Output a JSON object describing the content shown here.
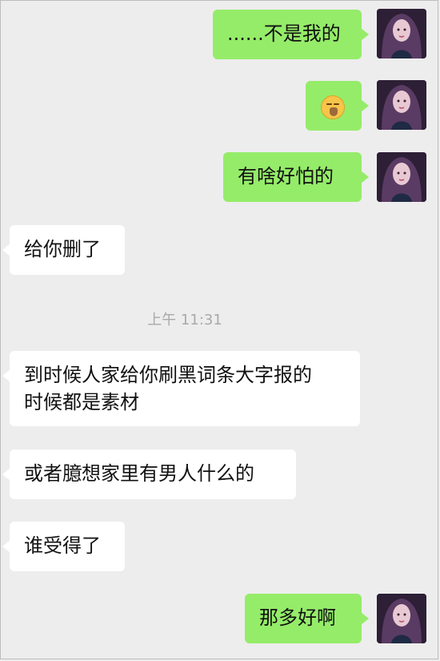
{
  "messages": [
    {
      "side": "out",
      "text": "......不是我的",
      "avatar": "girl-avatar"
    },
    {
      "side": "out",
      "text": "",
      "emoji": "speechless-face-icon",
      "avatar": "girl-avatar"
    },
    {
      "side": "out",
      "text": "有啥好怕的",
      "avatar": "girl-avatar"
    },
    {
      "side": "in",
      "text": "给你删了"
    },
    {
      "side": "in",
      "text_line1": "到时候人家给你刷黑词条大字报的",
      "text_line2": "时候都是素材"
    },
    {
      "side": "in",
      "text": "或者臆想家里有男人什么的"
    },
    {
      "side": "in",
      "text": "谁受得了"
    },
    {
      "side": "out",
      "text": "那多好啊",
      "avatar": "girl-avatar"
    }
  ],
  "timestamp": "上午 11:31",
  "colors": {
    "outgoing": "#95ec69",
    "incoming": "#ffffff",
    "background": "#ededed"
  }
}
